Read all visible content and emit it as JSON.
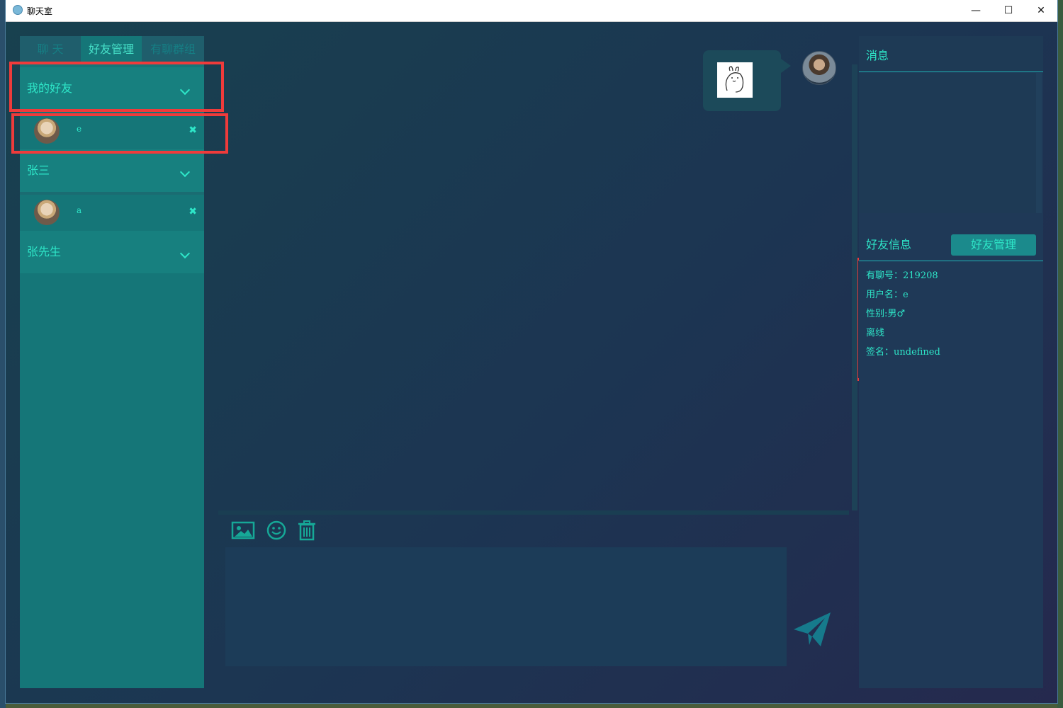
{
  "window": {
    "title": "聊天室",
    "controls": {
      "minimize": "—",
      "maximize": "☐",
      "close": "✕"
    }
  },
  "left_panel": {
    "tabs": [
      {
        "label": "聊  天",
        "active": false
      },
      {
        "label": "好友管理",
        "active": true
      },
      {
        "label": "有聊群组",
        "active": false
      }
    ],
    "groups": [
      {
        "label": "我的好友",
        "friends": [
          {
            "name": "e",
            "remove": "✖"
          }
        ]
      },
      {
        "label": "张三",
        "friends": [
          {
            "name": "a",
            "remove": "✖"
          }
        ]
      },
      {
        "label": "张先生",
        "friends": []
      }
    ]
  },
  "chat": {
    "messages": [
      {
        "from": "me",
        "type": "sticker",
        "icon": "sticker-image"
      }
    ],
    "toolbar": {
      "image": "image-icon",
      "emoji": "smiley-icon",
      "delete": "trash-icon"
    },
    "input": {
      "value": ""
    },
    "send": {
      "icon": "paper-plane-icon"
    }
  },
  "right_panel": {
    "messages_title": "消息",
    "friend_info_title": "好友信息",
    "manage_button": "好友管理",
    "info": {
      "id": "有聊号：219208",
      "username": "用户名：e",
      "gender": "性别:男♂",
      "status": "离线",
      "signature": "签名：undefined"
    }
  },
  "colors": {
    "accent": "#2ee6c8",
    "panel_teal": "#157678",
    "highlight_box": "#ef3b3b",
    "bg_dark": "#1c3552"
  }
}
